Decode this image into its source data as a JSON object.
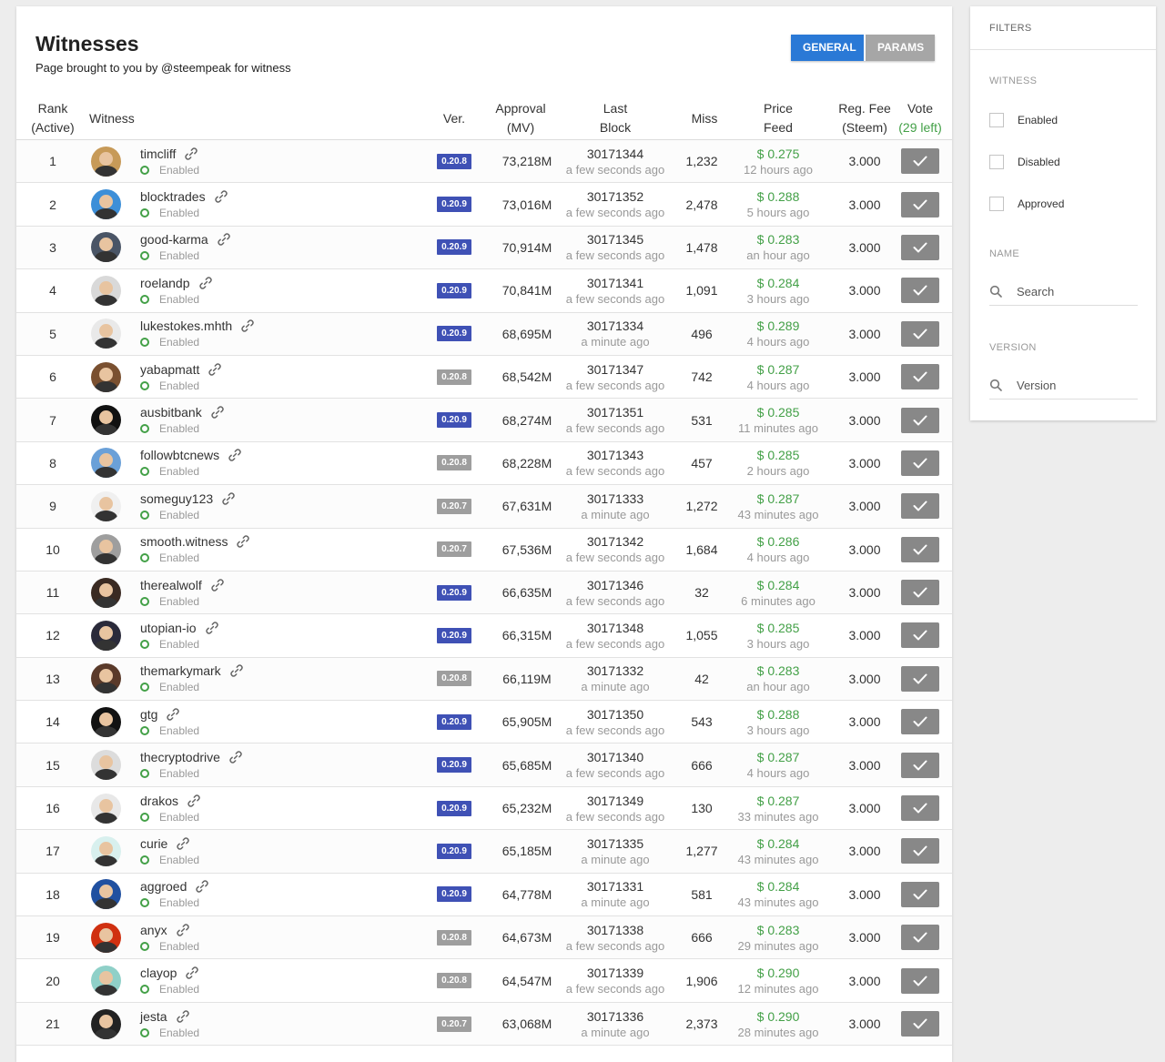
{
  "page": {
    "title": "Witnesses",
    "subtitle": "Page brought to you by @steempeak for witness"
  },
  "tabs": [
    {
      "label": "GENERAL",
      "active": true
    },
    {
      "label": "PARAMS",
      "active": false
    }
  ],
  "table": {
    "headers": {
      "rank": [
        "Rank",
        "(Active)"
      ],
      "witness": "Witness",
      "ver": "Ver.",
      "approval": [
        "Approval",
        "(MV)"
      ],
      "last_block": [
        "Last",
        "Block"
      ],
      "miss": "Miss",
      "price_feed": [
        "Price",
        "Feed"
      ],
      "reg_fee": [
        "Reg. Fee",
        "(Steem)"
      ],
      "vote": [
        "Vote",
        "(29 left)"
      ]
    },
    "rows": [
      {
        "rank": "1",
        "name": "timcliff",
        "status": "Enabled",
        "ver": "0.20.8",
        "ver_color": "blue",
        "approval": "73,218M",
        "block": "30171344",
        "block_time": "a few seconds ago",
        "miss": "1,232",
        "price": "$ 0.275",
        "price_time": "12 hours ago",
        "fee": "3.000",
        "avatar_color": "#c79a58"
      },
      {
        "rank": "2",
        "name": "blocktrades",
        "status": "Enabled",
        "ver": "0.20.9",
        "ver_color": "blue",
        "approval": "73,016M",
        "block": "30171352",
        "block_time": "a few seconds ago",
        "miss": "2,478",
        "price": "$ 0.288",
        "price_time": "5 hours ago",
        "fee": "3.000",
        "avatar_color": "#3d8fd8"
      },
      {
        "rank": "3",
        "name": "good-karma",
        "status": "Enabled",
        "ver": "0.20.9",
        "ver_color": "blue",
        "approval": "70,914M",
        "block": "30171345",
        "block_time": "a few seconds ago",
        "miss": "1,478",
        "price": "$ 0.283",
        "price_time": "an hour ago",
        "fee": "3.000",
        "avatar_color": "#4a5566"
      },
      {
        "rank": "4",
        "name": "roelandp",
        "status": "Enabled",
        "ver": "0.20.9",
        "ver_color": "blue",
        "approval": "70,841M",
        "block": "30171341",
        "block_time": "a few seconds ago",
        "miss": "1,091",
        "price": "$ 0.284",
        "price_time": "3 hours ago",
        "fee": "3.000",
        "avatar_color": "#d9d9d9"
      },
      {
        "rank": "5",
        "name": "lukestokes.mhth",
        "status": "Enabled",
        "ver": "0.20.9",
        "ver_color": "blue",
        "approval": "68,695M",
        "block": "30171334",
        "block_time": "a minute ago",
        "miss": "496",
        "price": "$ 0.289",
        "price_time": "4 hours ago",
        "fee": "3.000",
        "avatar_color": "#e9e9e9"
      },
      {
        "rank": "6",
        "name": "yabapmatt",
        "status": "Enabled",
        "ver": "0.20.8",
        "ver_color": "gray",
        "approval": "68,542M",
        "block": "30171347",
        "block_time": "a few seconds ago",
        "miss": "742",
        "price": "$ 0.287",
        "price_time": "4 hours ago",
        "fee": "3.000",
        "avatar_color": "#7a5030"
      },
      {
        "rank": "7",
        "name": "ausbitbank",
        "status": "Enabled",
        "ver": "0.20.9",
        "ver_color": "blue",
        "approval": "68,274M",
        "block": "30171351",
        "block_time": "a few seconds ago",
        "miss": "531",
        "price": "$ 0.285",
        "price_time": "11 minutes ago",
        "fee": "3.000",
        "avatar_color": "#111111"
      },
      {
        "rank": "8",
        "name": "followbtcnews",
        "status": "Enabled",
        "ver": "0.20.8",
        "ver_color": "gray",
        "approval": "68,228M",
        "block": "30171343",
        "block_time": "a few seconds ago",
        "miss": "457",
        "price": "$ 0.285",
        "price_time": "2 hours ago",
        "fee": "3.000",
        "avatar_color": "#6aa0d8"
      },
      {
        "rank": "9",
        "name": "someguy123",
        "status": "Enabled",
        "ver": "0.20.7",
        "ver_color": "gray",
        "approval": "67,631M",
        "block": "30171333",
        "block_time": "a minute ago",
        "miss": "1,272",
        "price": "$ 0.287",
        "price_time": "43 minutes ago",
        "fee": "3.000",
        "avatar_color": "#f0f0f0"
      },
      {
        "rank": "10",
        "name": "smooth.witness",
        "status": "Enabled",
        "ver": "0.20.7",
        "ver_color": "gray",
        "approval": "67,536M",
        "block": "30171342",
        "block_time": "a few seconds ago",
        "miss": "1,684",
        "price": "$ 0.286",
        "price_time": "4 hours ago",
        "fee": "3.000",
        "avatar_color": "#9e9e9e"
      },
      {
        "rank": "11",
        "name": "therealwolf",
        "status": "Enabled",
        "ver": "0.20.9",
        "ver_color": "blue",
        "approval": "66,635M",
        "block": "30171346",
        "block_time": "a few seconds ago",
        "miss": "32",
        "price": "$ 0.284",
        "price_time": "6 minutes ago",
        "fee": "3.000",
        "avatar_color": "#3a2a22"
      },
      {
        "rank": "12",
        "name": "utopian-io",
        "status": "Enabled",
        "ver": "0.20.9",
        "ver_color": "blue",
        "approval": "66,315M",
        "block": "30171348",
        "block_time": "a few seconds ago",
        "miss": "1,055",
        "price": "$ 0.285",
        "price_time": "3 hours ago",
        "fee": "3.000",
        "avatar_color": "#2a2a3a"
      },
      {
        "rank": "13",
        "name": "themarkymark",
        "status": "Enabled",
        "ver": "0.20.8",
        "ver_color": "gray",
        "approval": "66,119M",
        "block": "30171332",
        "block_time": "a minute ago",
        "miss": "42",
        "price": "$ 0.283",
        "price_time": "an hour ago",
        "fee": "3.000",
        "avatar_color": "#5a3a2a"
      },
      {
        "rank": "14",
        "name": "gtg",
        "status": "Enabled",
        "ver": "0.20.9",
        "ver_color": "blue",
        "approval": "65,905M",
        "block": "30171350",
        "block_time": "a few seconds ago",
        "miss": "543",
        "price": "$ 0.288",
        "price_time": "3 hours ago",
        "fee": "3.000",
        "avatar_color": "#121212"
      },
      {
        "rank": "15",
        "name": "thecryptodrive",
        "status": "Enabled",
        "ver": "0.20.9",
        "ver_color": "blue",
        "approval": "65,685M",
        "block": "30171340",
        "block_time": "a few seconds ago",
        "miss": "666",
        "price": "$ 0.287",
        "price_time": "4 hours ago",
        "fee": "3.000",
        "avatar_color": "#dcdcdc"
      },
      {
        "rank": "16",
        "name": "drakos",
        "status": "Enabled",
        "ver": "0.20.9",
        "ver_color": "blue",
        "approval": "65,232M",
        "block": "30171349",
        "block_time": "a few seconds ago",
        "miss": "130",
        "price": "$ 0.287",
        "price_time": "33 minutes ago",
        "fee": "3.000",
        "avatar_color": "#e8e8e8"
      },
      {
        "rank": "17",
        "name": "curie",
        "status": "Enabled",
        "ver": "0.20.9",
        "ver_color": "blue",
        "approval": "65,185M",
        "block": "30171335",
        "block_time": "a minute ago",
        "miss": "1,277",
        "price": "$ 0.284",
        "price_time": "43 minutes ago",
        "fee": "3.000",
        "avatar_color": "#d8f0ee"
      },
      {
        "rank": "18",
        "name": "aggroed",
        "status": "Enabled",
        "ver": "0.20.9",
        "ver_color": "blue",
        "approval": "64,778M",
        "block": "30171331",
        "block_time": "a minute ago",
        "miss": "581",
        "price": "$ 0.284",
        "price_time": "43 minutes ago",
        "fee": "3.000",
        "avatar_color": "#2050a0"
      },
      {
        "rank": "19",
        "name": "anyx",
        "status": "Enabled",
        "ver": "0.20.8",
        "ver_color": "gray",
        "approval": "64,673M",
        "block": "30171338",
        "block_time": "a few seconds ago",
        "miss": "666",
        "price": "$ 0.283",
        "price_time": "29 minutes ago",
        "fee": "3.000",
        "avatar_color": "#d03010"
      },
      {
        "rank": "20",
        "name": "clayop",
        "status": "Enabled",
        "ver": "0.20.8",
        "ver_color": "gray",
        "approval": "64,547M",
        "block": "30171339",
        "block_time": "a few seconds ago",
        "miss": "1,906",
        "price": "$ 0.290",
        "price_time": "12 minutes ago",
        "fee": "3.000",
        "avatar_color": "#8fd0c8"
      },
      {
        "rank": "21",
        "name": "jesta",
        "status": "Enabled",
        "ver": "0.20.7",
        "ver_color": "gray",
        "approval": "63,068M",
        "block": "30171336",
        "block_time": "a minute ago",
        "miss": "2,373",
        "price": "$ 0.290",
        "price_time": "28 minutes ago",
        "fee": "3.000",
        "avatar_color": "#222222"
      }
    ]
  },
  "filters": {
    "title": "FILTERS",
    "witness_section": "WITNESS",
    "checkboxes": [
      "Enabled",
      "Disabled",
      "Approved"
    ],
    "name_section": "NAME",
    "name_placeholder": "Search",
    "version_section": "VERSION",
    "version_placeholder": "Version"
  },
  "colors": {
    "accent_blue": "#2a79d6",
    "version_blue": "#3f51b5",
    "version_gray": "#9e9e9e",
    "price_green": "#43a047",
    "vote_button": "#888888"
  },
  "icons": {
    "link": "link-icon",
    "status": "status-dot-icon",
    "vote": "check-icon",
    "search": "search-icon"
  }
}
